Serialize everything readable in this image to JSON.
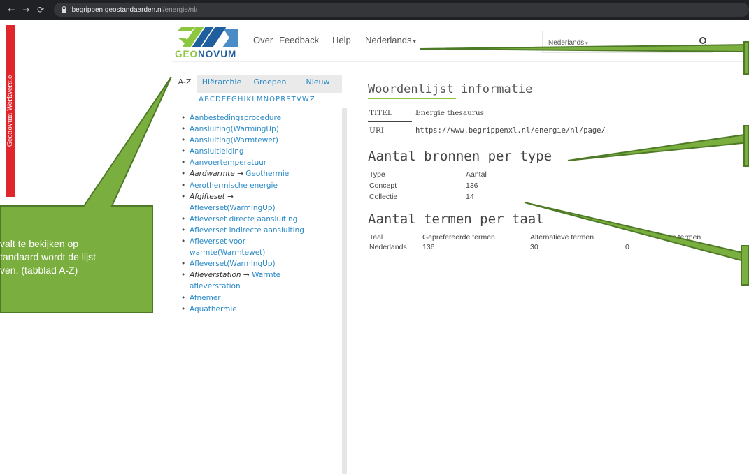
{
  "browser": {
    "url_host": "begrippen.geostandaarden.nl",
    "url_path": "/energie/nl/",
    "back_icon": "←",
    "forward_icon": "→",
    "reload_icon": "⟳"
  },
  "banner": {
    "text": "Geonovum Werkversie",
    "color": "#e0262b"
  },
  "header": {
    "logo_text_geo": "GEO",
    "logo_text_novum": "NOVUM",
    "nav": [
      "Over",
      "Feedback",
      "Help",
      "Nederlands"
    ],
    "search_lang": "Nederlands",
    "search_placeholder": ""
  },
  "sidebar": {
    "tabs": [
      "A-Z",
      "Hiërarchie",
      "Groepen",
      "Nieuw"
    ],
    "active_tab": "A-Z",
    "alphabet": "ABCDEFGHIKLMNOPRSTVWZ",
    "terms": {
      "t1": "Aanbestedingsprocedure",
      "t2": "Aansluiting(WarmingUp)",
      "t3": "Aansluiting(Warmtewet)",
      "t4": "Aansluitleiding",
      "t5": "Aanvoertemperatuur",
      "t6_alt": "Aardwarmte",
      "t6_pref": "Geothermie",
      "t7": "Aerothermische energie",
      "t8_alt": "Afgifteset",
      "t8_pref": "Afleverset(WarmingUp)",
      "t9": "Afleverset directe aansluiting",
      "t10": "Afleverset indirecte aansluiting",
      "t11": "Afleverset voor warmte(Warmtewet)",
      "t12": "Afleverset(WarmingUp)",
      "t13_alt": "Afleverstation",
      "t13_pref": "Warmte afleverstation",
      "t14": "Afnemer",
      "t15": "Aquathermie",
      "arrow": "→"
    }
  },
  "main": {
    "info_heading": "Woordenlijst informatie",
    "title_label": "TITEL",
    "title_value": "Energie thesaurus",
    "uri_label": "URI",
    "uri_value": "https://www.begrippenxl.nl/energie/nl/page/",
    "sources_heading": "Aantal bronnen per type",
    "sources": {
      "col_type": "Type",
      "col_count": "Aantal",
      "row1_type": "Concept",
      "row1_count": "136",
      "row2_type": "Collectie",
      "row2_count": "14"
    },
    "terms_heading": "Aantal termen per taal",
    "terms_table": {
      "col_lang": "Taal",
      "col_pref": "Geprefereerde termen",
      "col_alt": "Alternatieve termen",
      "col_hidden": "en termen",
      "lang": "Nederlands",
      "pref": "136",
      "alt": "30",
      "hidden": "0"
    }
  },
  "callout": {
    "line1": "valt te bekijken op",
    "line2": "tandaard wordt de lijst",
    "line3": "ven. (tabblad A-Z)",
    "color": "#7aaf3f"
  }
}
